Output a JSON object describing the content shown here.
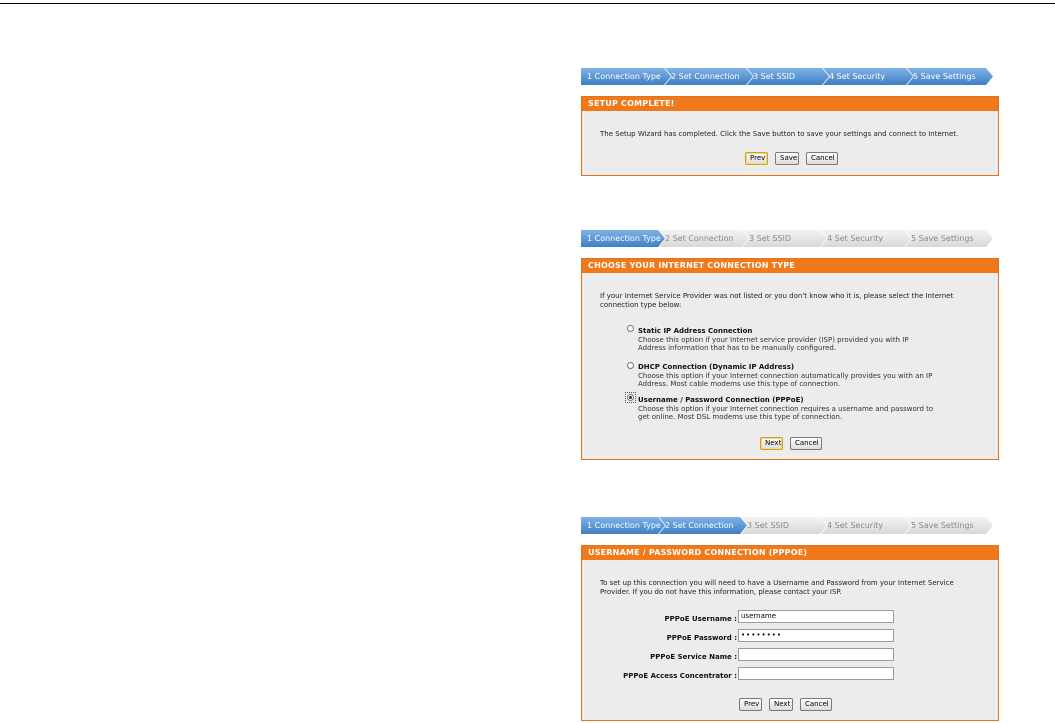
{
  "wizard_steps": [
    "1 Connection Type",
    "2 Set Connection",
    "3 Set SSID",
    "4 Set Security",
    "5 Save Settings"
  ],
  "panel1": {
    "title": "SETUP COMPLETE!",
    "message": "The Setup Wizard has completed. Click the Save button to save your settings and connect to Internet.",
    "buttons": {
      "prev": "Prev",
      "save": "Save",
      "cancel": "Cancel"
    }
  },
  "panel2": {
    "title": "CHOOSE YOUR INTERNET CONNECTION TYPE",
    "intro": "If your Internet Service Provider was not listed or you don't know who it is, please select the Internet connection type below:",
    "options": [
      {
        "title": "Static IP Address Connection",
        "desc": "Choose this option if your Internet service provider (ISP) provided you with IP Address information that has to be manually configured."
      },
      {
        "title": "DHCP Connection (Dynamic IP Address)",
        "desc": "Choose this option if your Internet connection automatically provides you with an IP Address. Most cable modems use this type of connection."
      },
      {
        "title": "Username / Password Connection (PPPoE)",
        "desc": "Choose this option if your Internet connection requires a username and password to get online. Most DSL modems use this type of connection."
      }
    ],
    "buttons": {
      "next": "Next",
      "cancel": "Cancel"
    }
  },
  "panel3": {
    "title": "USERNAME / PASSWORD CONNECTION (PPPOE)",
    "intro": "To set up this connection you will need to have a Username and Password from your Internet Service Provider. If you do not have this information, please contact your ISP.",
    "fields": [
      {
        "label": "PPPoE Username :",
        "value": "username"
      },
      {
        "label": "PPPoE Password :",
        "value": "••••••••"
      },
      {
        "label": "PPPoE Service Name :",
        "value": ""
      },
      {
        "label": "PPPoE Access Concentrator :",
        "value": ""
      }
    ],
    "buttons": {
      "prev": "Prev",
      "next": "Next",
      "cancel": "Cancel"
    }
  },
  "colors": {
    "accent_orange": "#f0791b",
    "step_active_blue": "#3f7fc6",
    "panel_bg": "#ececec"
  }
}
